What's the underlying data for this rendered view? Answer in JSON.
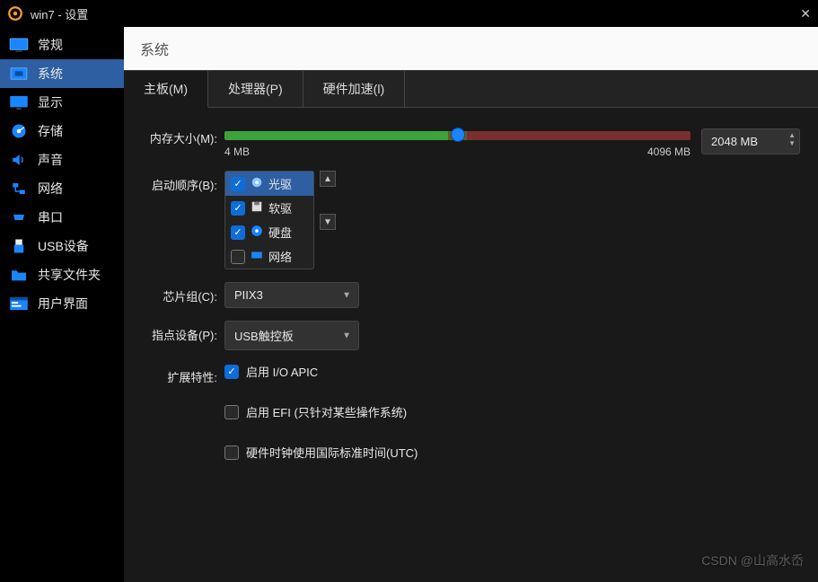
{
  "window": {
    "title": "win7 - 设置"
  },
  "sidebar": {
    "items": [
      {
        "label": "常规",
        "selected": false
      },
      {
        "label": "系统",
        "selected": true
      },
      {
        "label": "显示",
        "selected": false
      },
      {
        "label": "存储",
        "selected": false
      },
      {
        "label": "声音",
        "selected": false
      },
      {
        "label": "网络",
        "selected": false
      },
      {
        "label": "串口",
        "selected": false
      },
      {
        "label": "USB设备",
        "selected": false
      },
      {
        "label": "共享文件夹",
        "selected": false
      },
      {
        "label": "用户界面",
        "selected": false
      }
    ]
  },
  "header": {
    "title": "系统"
  },
  "tabs": [
    {
      "label": "主板(M)",
      "active": true
    },
    {
      "label": "处理器(P)",
      "active": false
    },
    {
      "label": "硬件加速(l)",
      "active": false
    }
  ],
  "memory": {
    "label": "内存大小(M):",
    "min_label": "4 MB",
    "max_label": "4096 MB",
    "value_text": "2048 MB",
    "thumb_pct": 50
  },
  "bootorder": {
    "label": "启动顺序(B):",
    "items": [
      {
        "label": "光驱",
        "checked": true,
        "selected": true
      },
      {
        "label": "软驱",
        "checked": true,
        "selected": false
      },
      {
        "label": "硬盘",
        "checked": true,
        "selected": false
      },
      {
        "label": "网络",
        "checked": false,
        "selected": false
      }
    ]
  },
  "chipset": {
    "label": "芯片组(C):",
    "value": "PIIX3"
  },
  "pointer": {
    "label": "指点设备(P):",
    "value": "USB触控板"
  },
  "extras": {
    "label": "扩展特性:",
    "ioapic": {
      "text": "启用 I/O APIC",
      "checked": true
    },
    "efi": {
      "text": "启用 EFI (只针对某些操作系统)",
      "checked": false
    },
    "utc": {
      "text": "硬件时钟使用国际标准时间(UTC)",
      "checked": false
    }
  },
  "watermark": "CSDN @山高水岙"
}
